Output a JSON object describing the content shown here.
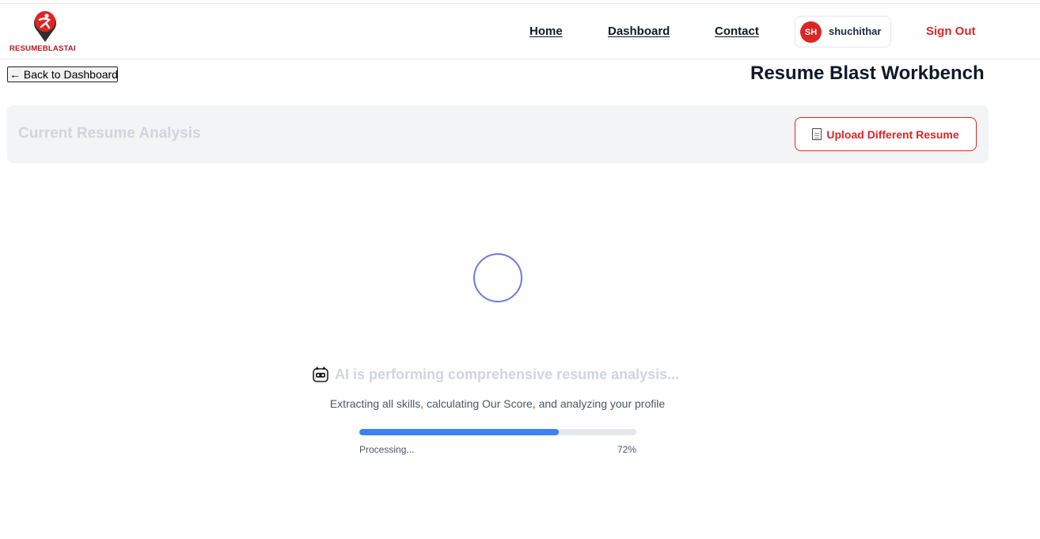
{
  "brand": {
    "logo_text": "RESUMEBLASTAI",
    "accent_color": "#dc2626"
  },
  "nav": {
    "home": "Home",
    "dashboard": "Dashboard",
    "contact": "Contact",
    "user_initials": "SH",
    "username": "shuchithar",
    "sign_out": "Sign Out"
  },
  "subheader": {
    "back_label": "← Back to Dashboard",
    "page_title": "Resume Blast Workbench"
  },
  "analysis_card": {
    "title": "Current Resume Analysis",
    "upload_label": "Upload Different Resume",
    "upload_icon": "document-icon"
  },
  "loading": {
    "spinner_icon": "loading-spinner-icon",
    "status_icon": "robot-icon",
    "status_text": "AI is performing comprehensive resume analysis...",
    "subtitle": "Extracting all skills, calculating Our Score, and analyzing your profile",
    "progress_label": "Processing...",
    "progress_percent_label": "72%",
    "progress_value": 0.72,
    "progress_color": "#3b82f6"
  }
}
